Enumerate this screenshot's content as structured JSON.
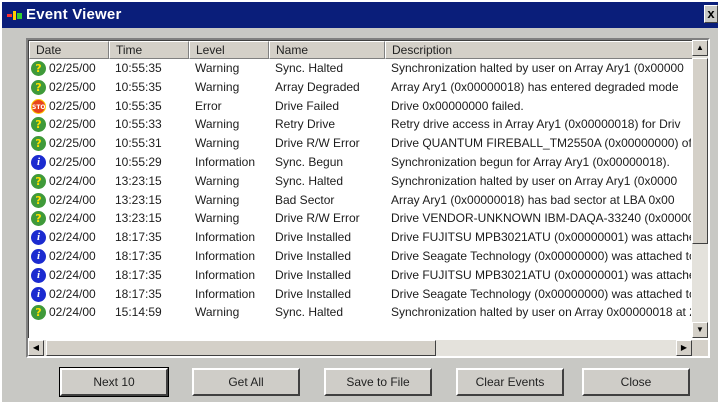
{
  "window": {
    "title": "Event Viewer",
    "close_glyph": "x"
  },
  "columns": [
    "Date",
    "Time",
    "Level",
    "Name",
    "Description"
  ],
  "rows": [
    {
      "icon": "warning",
      "date": "02/25/00",
      "time": "10:55:35",
      "level": "Warning",
      "name": "Sync. Halted",
      "desc": "Synchronization halted by user on Array Ary1       (0x00000"
    },
    {
      "icon": "warning",
      "date": "02/25/00",
      "time": "10:55:35",
      "level": "Warning",
      "name": "Array Degraded",
      "desc": "Array Ary1       (0x00000018) has entered degraded mode"
    },
    {
      "icon": "error",
      "date": "02/25/00",
      "time": "10:55:35",
      "level": "Error",
      "name": "Drive Failed",
      "desc": "Drive 0x00000000 failed."
    },
    {
      "icon": "warning",
      "date": "02/25/00",
      "time": "10:55:33",
      "level": "Warning",
      "name": "Retry Drive",
      "desc": "Retry drive access in Array Ary1       (0x00000018) for Driv"
    },
    {
      "icon": "warning",
      "date": "02/25/00",
      "time": "10:55:31",
      "level": "Warning",
      "name": "Drive R/W Error",
      "desc": "Drive QUANTUM FIREBALL_TM2550A (0x00000000) of /"
    },
    {
      "icon": "info",
      "date": "02/25/00",
      "time": "10:55:29",
      "level": "Information",
      "name": "Sync. Begun",
      "desc": "Synchronization begun for Array Ary1       (0x00000018)."
    },
    {
      "icon": "warning",
      "date": "02/24/00",
      "time": "13:23:15",
      "level": "Warning",
      "name": "Sync. Halted",
      "desc": "Synchronization halted by user on Array Ary1       (0x0000"
    },
    {
      "icon": "warning",
      "date": "02/24/00",
      "time": "13:23:15",
      "level": "Warning",
      "name": "Bad Sector",
      "desc": "Array Ary1       (0x00000018) has bad sector at LBA 0x00"
    },
    {
      "icon": "warning",
      "date": "02/24/00",
      "time": "13:23:15",
      "level": "Warning",
      "name": "Drive R/W Error",
      "desc": "Drive VENDOR-UNKNOWN IBM-DAQA-33240 (0x000000"
    },
    {
      "icon": "info",
      "date": "02/24/00",
      "time": "18:17:35",
      "level": "Information",
      "name": "Drive Installed",
      "desc": "Drive FUJITSU MPB3021ATU (0x00000001) was attache"
    },
    {
      "icon": "info",
      "date": "02/24/00",
      "time": "18:17:35",
      "level": "Information",
      "name": "Drive Installed",
      "desc": "Drive Seagate Technology (0x00000000) was attached to"
    },
    {
      "icon": "info",
      "date": "02/24/00",
      "time": "18:17:35",
      "level": "Information",
      "name": "Drive Installed",
      "desc": "Drive FUJITSU MPB3021ATU (0x00000001) was attache"
    },
    {
      "icon": "info",
      "date": "02/24/00",
      "time": "18:17:35",
      "level": "Information",
      "name": "Drive Installed",
      "desc": "Drive Seagate Technology (0x00000000) was attached to"
    },
    {
      "icon": "warning",
      "date": "02/24/00",
      "time": "15:14:59",
      "level": "Warning",
      "name": "Sync. Halted",
      "desc": "Synchronization halted by user on Array 0x00000018 at 2E"
    }
  ],
  "icon_glyphs": {
    "warning": "?",
    "info": "i",
    "error": "STOP"
  },
  "scroll": {
    "up": "▲",
    "down": "▼",
    "left": "◀",
    "right": "▶"
  },
  "buttons": {
    "next": "Next 10",
    "get_all": "Get All",
    "save": "Save to File",
    "clear": "Clear Events",
    "close": "Close"
  },
  "colors": {
    "titlebar": "#0a1e7a",
    "warning_icon": "#3f9a3a",
    "info_icon": "#1b2bd0",
    "error_icon": "#e7441c"
  }
}
